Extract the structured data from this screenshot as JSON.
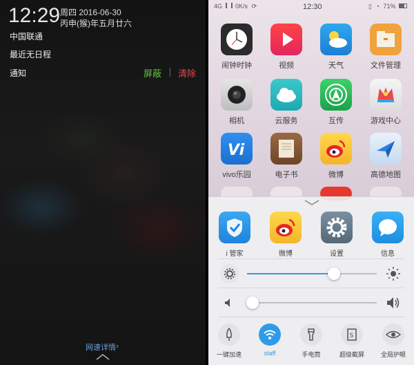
{
  "lock_screen": {
    "time": "12:29",
    "date": "周四 2016-06-30",
    "lunar_date": "丙申(猴)年五月廿六",
    "carrier": "中国联通",
    "schedule": "最近无日程",
    "notifications_label": "通知",
    "shield_label": "屏蔽",
    "clear_label": "清除",
    "network_speed_label": "网速详情"
  },
  "status_bar": {
    "network": "4G",
    "speed": "0K/s",
    "time": "12:30",
    "battery": "71%"
  },
  "apps": [
    {
      "label": "闹钟时钟",
      "icon": "clock-icon"
    },
    {
      "label": "视频",
      "icon": "video-icon"
    },
    {
      "label": "天气",
      "icon": "weather-icon"
    },
    {
      "label": "文件管理",
      "icon": "file-manager-icon"
    },
    {
      "label": "相机",
      "icon": "camera-icon"
    },
    {
      "label": "云服务",
      "icon": "cloud-service-icon"
    },
    {
      "label": "互传",
      "icon": "transfer-icon"
    },
    {
      "label": "游戏中心",
      "icon": "game-center-icon"
    },
    {
      "label": "vivo乐园",
      "icon": "vivo-park-icon"
    },
    {
      "label": "电子书",
      "icon": "ebook-icon"
    },
    {
      "label": "微博",
      "icon": "weibo-icon"
    },
    {
      "label": "高德地图",
      "icon": "amap-icon"
    }
  ],
  "quick_apps": [
    {
      "label": "i 管家",
      "icon": "i-manager-icon"
    },
    {
      "label": "微博",
      "icon": "weibo-icon"
    },
    {
      "label": "设置",
      "icon": "settings-icon"
    },
    {
      "label": "信息",
      "icon": "messages-icon"
    }
  ],
  "brightness": {
    "level": 0.67
  },
  "volume": {
    "level": 0.04
  },
  "toggles": [
    {
      "label": "一键加速",
      "icon": "rocket-icon",
      "active": false
    },
    {
      "label": "staff",
      "icon": "wifi-icon",
      "active": true
    },
    {
      "label": "手电筒",
      "icon": "flashlight-icon",
      "active": false
    },
    {
      "label": "超级截屏",
      "icon": "screenshot-icon",
      "active": false
    },
    {
      "label": "全局护眼",
      "icon": "eye-icon",
      "active": false
    }
  ],
  "colors": {
    "accent": "#2f9be6",
    "shield": "#5fbf46",
    "clear": "#e94545"
  }
}
